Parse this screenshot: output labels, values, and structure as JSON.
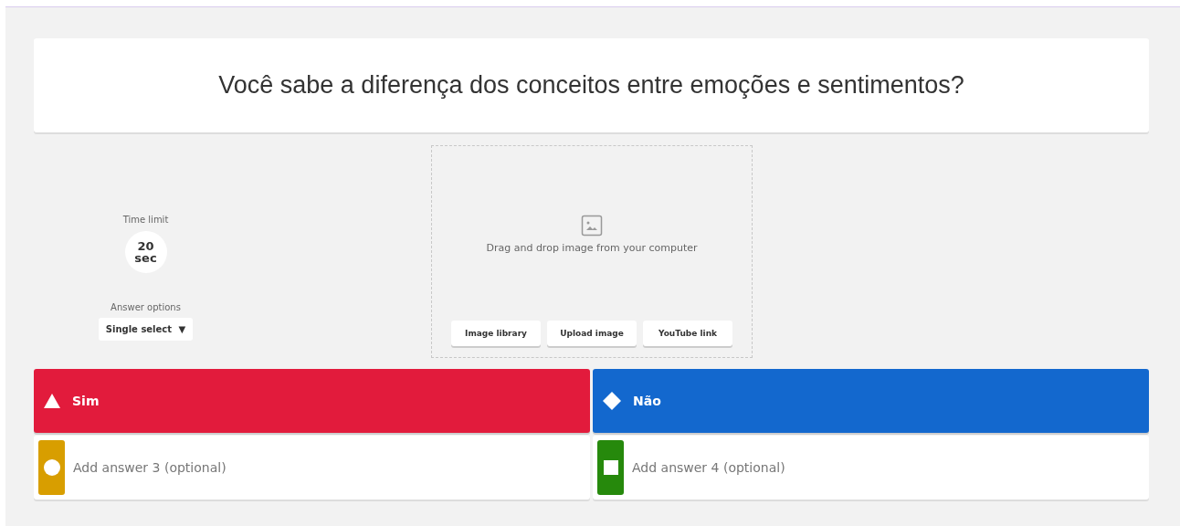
{
  "question": {
    "text": "Você sabe a diferença dos conceitos entre emoções e sentimentos?"
  },
  "time_limit": {
    "label": "Time limit",
    "value": "20",
    "unit": "sec"
  },
  "answer_options": {
    "label": "Answer options",
    "value": "Single select",
    "caret": "▼"
  },
  "media": {
    "hint": "Drag and drop image from your computer",
    "buttons": [
      "Image library",
      "Upload image",
      "YouTube link"
    ]
  },
  "answers": [
    {
      "kind": "triangle",
      "color": "#e21b3c",
      "text": "Sim"
    },
    {
      "kind": "diamond",
      "color": "#1368ce",
      "text": "Não"
    },
    {
      "kind": "circle",
      "color": "#d89e00",
      "placeholder": "Add answer 3 (optional)"
    },
    {
      "kind": "square",
      "color": "#26890c",
      "placeholder": "Add answer 4 (optional)"
    }
  ]
}
